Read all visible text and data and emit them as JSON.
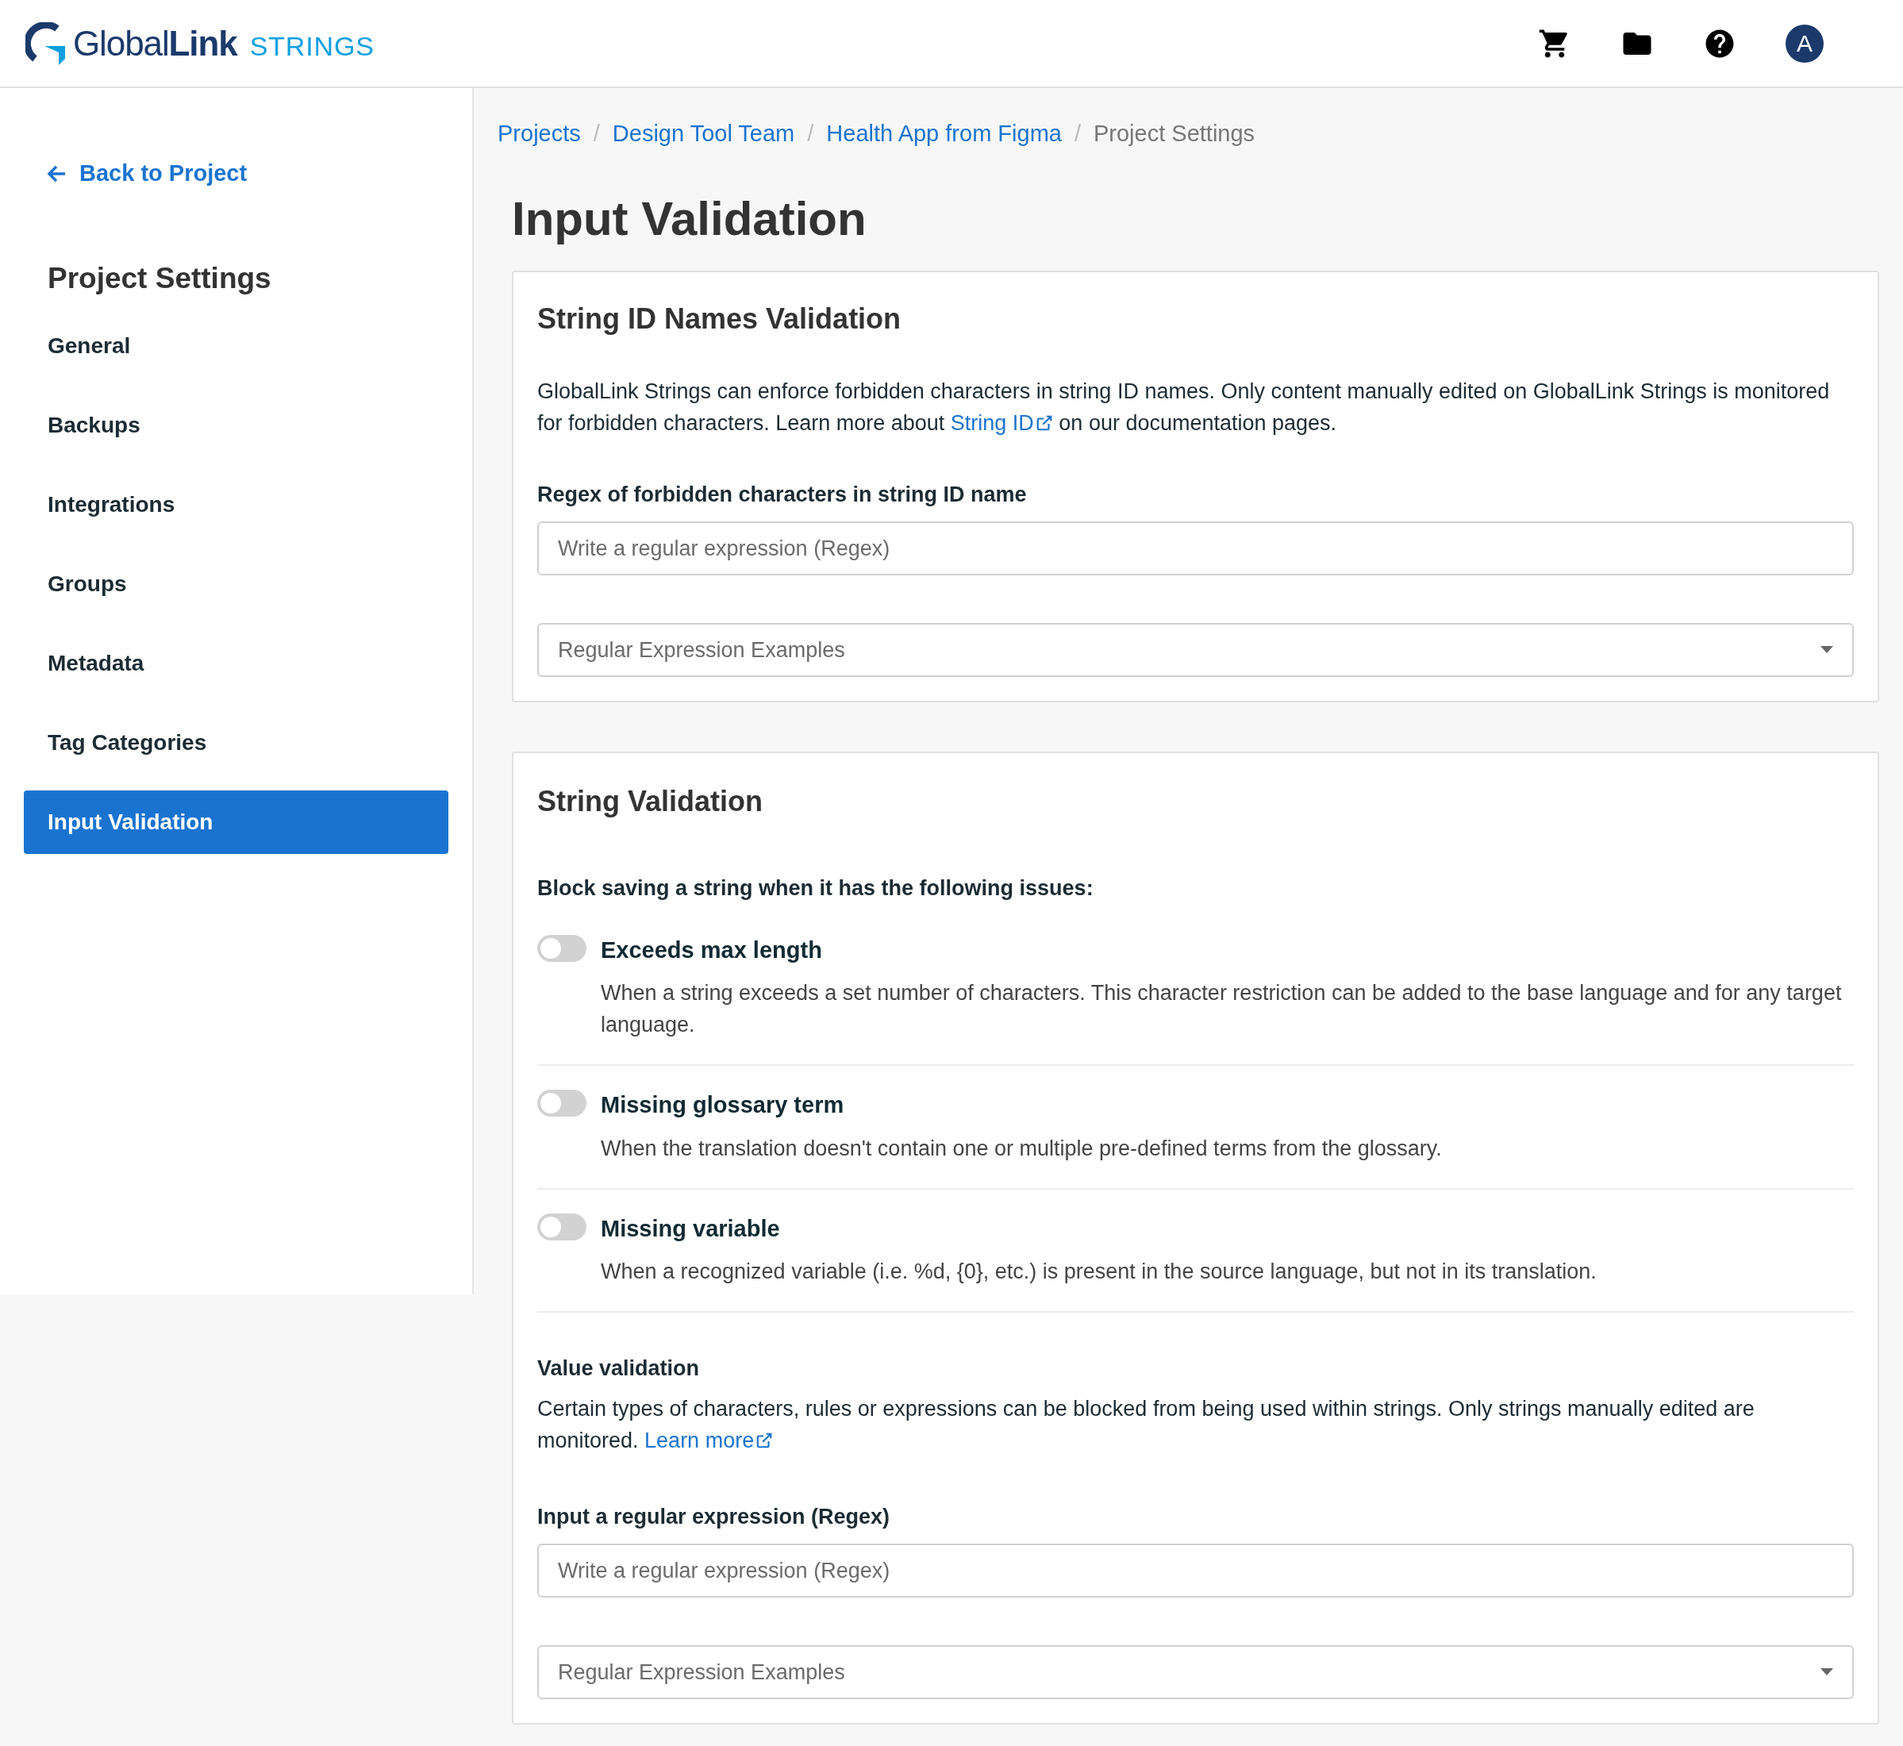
{
  "header": {
    "logo_main": "Global",
    "logo_bold": "Link",
    "logo_product": "STRINGS",
    "avatar": "A"
  },
  "sidebar": {
    "back": "Back to Project",
    "title": "Project Settings",
    "items": [
      {
        "label": "General",
        "selected": false
      },
      {
        "label": "Backups",
        "selected": false
      },
      {
        "label": "Integrations",
        "selected": false
      },
      {
        "label": "Groups",
        "selected": false
      },
      {
        "label": "Metadata",
        "selected": false
      },
      {
        "label": "Tag Categories",
        "selected": false
      },
      {
        "label": "Input Validation",
        "selected": true
      }
    ]
  },
  "breadcrumbs": [
    {
      "label": "Projects",
      "link": true
    },
    {
      "separator": "/",
      "label": "Design Tool Team",
      "link": true
    },
    {
      "separator": "/",
      "label": "Health App from Figma",
      "link": true
    },
    {
      "separator": "/",
      "label": "Project Settings",
      "link": false
    }
  ],
  "page_title": "Input Validation",
  "id_card": {
    "title": "String ID Names Validation",
    "description": {
      "before": "GlobalLink Strings can enforce forbidden characters in string ID names. Only content manually edited on GlobalLink Strings is monitored for forbidden characters. Learn more about ",
      "link": "String ID",
      "after": " on our documentation pages."
    },
    "field_label": "Regex of forbidden characters in string ID name",
    "field_placeholder": "Write a regular expression (Regex)",
    "select_placeholder": "Regular Expression Examples"
  },
  "string_card": {
    "title": "String Validation",
    "subtitle": "Block saving a string when it has the following issues:",
    "rules": [
      {
        "title": "Exceeds max length",
        "description": "When a string exceeds a set number of characters. This character restriction can be added to the base language and for any target language.",
        "on": false
      },
      {
        "title": "Missing glossary term",
        "description": "When the translation doesn't contain one or multiple pre-defined terms from the glossary.",
        "on": false
      },
      {
        "title": "Missing variable",
        "description": "When a recognized variable (i.e. %d, {0}, etc.) is present in the source language, but not in its translation.",
        "on": false
      }
    ],
    "value_title": "Value validation",
    "value_description": {
      "before": "Certain types of characters, rules or expressions can be blocked from being used within strings. Only strings manually edited are monitored. ",
      "link": "Learn more"
    },
    "field_label": "Input a regular expression (Regex)",
    "field_placeholder": "Write a regular expression (Regex)",
    "select_placeholder": "Regular Expression Examples"
  }
}
